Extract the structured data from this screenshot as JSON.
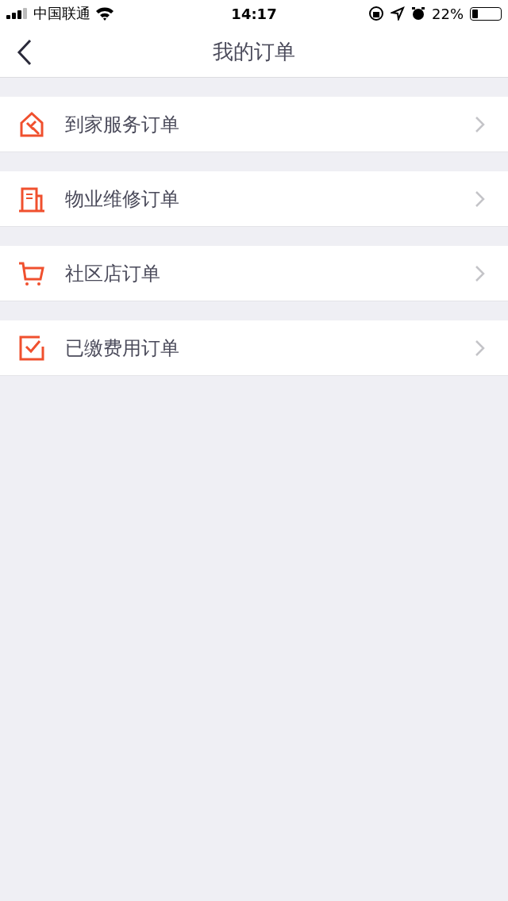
{
  "status_bar": {
    "carrier": "中国联通",
    "time": "14:17",
    "battery": "22%"
  },
  "nav": {
    "title": "我的订单"
  },
  "items": [
    {
      "label": "到家服务订单",
      "kind": "house"
    },
    {
      "label": "物业维修订单",
      "kind": "building"
    },
    {
      "label": "社区店订单",
      "kind": "cart"
    },
    {
      "label": "已缴费用订单",
      "kind": "check"
    }
  ]
}
